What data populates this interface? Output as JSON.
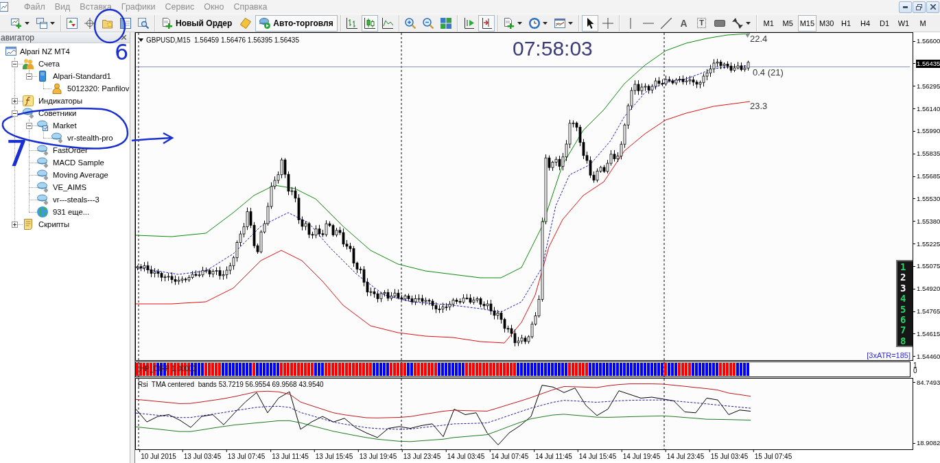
{
  "menu": {
    "items": [
      "Файл",
      "Вид",
      "Вставка",
      "Графики",
      "Сервис",
      "Окно",
      "Справка"
    ]
  },
  "toolbar": {
    "groups": [
      {
        "items": [
          {
            "kind": "icon",
            "pressed": false,
            "dropdown": true
          },
          {
            "kind": "icon",
            "pressed": false,
            "dropdown": true
          }
        ]
      },
      {
        "items": [
          {
            "kind": "icon",
            "pressed": false
          },
          {
            "kind": "icon",
            "pressed": false
          },
          {
            "kind": "icon",
            "pressed": false
          },
          {
            "kind": "icon",
            "pressed": false
          },
          {
            "kind": "icon",
            "pressed": false
          }
        ]
      },
      {
        "items": [
          {
            "kind": "button",
            "label": "Новый Ордер",
            "pressed": false
          },
          {
            "kind": "icon",
            "pressed": false
          },
          {
            "kind": "button",
            "label": "Авто-торговля",
            "pressed": true
          }
        ]
      },
      {
        "items": [
          {
            "kind": "icon",
            "pressed": false
          },
          {
            "kind": "icon",
            "pressed": true
          },
          {
            "kind": "icon",
            "pressed": false
          }
        ]
      },
      {
        "items": [
          {
            "kind": "icon",
            "pressed": false
          },
          {
            "kind": "icon",
            "pressed": false
          },
          {
            "kind": "icon",
            "pressed": false
          }
        ]
      },
      {
        "items": [
          {
            "kind": "icon",
            "pressed": false
          },
          {
            "kind": "icon",
            "pressed": true
          }
        ]
      },
      {
        "items": [
          {
            "kind": "icon",
            "pressed": false,
            "dropdown": true
          },
          {
            "kind": "icon",
            "pressed": false,
            "dropdown": true
          },
          {
            "kind": "icon",
            "pressed": false,
            "dropdown": true
          }
        ]
      },
      {
        "items": [
          {
            "kind": "icon",
            "pressed": true
          },
          {
            "kind": "icon",
            "pressed": false
          }
        ]
      },
      {
        "items": [
          {
            "kind": "icon",
            "pressed": false
          },
          {
            "kind": "icon",
            "pressed": false
          },
          {
            "kind": "icon",
            "pressed": false
          },
          {
            "kind": "glyph",
            "label": "A",
            "pressed": false
          },
          {
            "kind": "boxed-glyph",
            "label": "T",
            "pressed": false
          },
          {
            "kind": "icon",
            "pressed": false
          },
          {
            "kind": "icon",
            "pressed": false,
            "dropdown": true
          }
        ]
      }
    ]
  },
  "timeframes": [
    {
      "label": "M1",
      "selected": false
    },
    {
      "label": "M5",
      "selected": false
    },
    {
      "label": "M15",
      "selected": true
    },
    {
      "label": "M30",
      "selected": false
    },
    {
      "label": "H1",
      "selected": false
    },
    {
      "label": "H4",
      "selected": false
    },
    {
      "label": "D1",
      "selected": false
    },
    {
      "label": "W1",
      "selected": false
    },
    {
      "label": "M",
      "selected": false
    }
  ],
  "navigator": {
    "title": "авигатор",
    "tree": [
      {
        "label": "Alpari NZ MT4",
        "kind": "terminal",
        "children": [
          {
            "label": "Счета",
            "kind": "accounts",
            "expanded": true,
            "children": [
              {
                "label": "Alpari-Standard1",
                "kind": "server",
                "expanded": true,
                "children": [
                  {
                    "label": "5012320: Panfilov",
                    "kind": "account"
                  }
                ]
              }
            ]
          },
          {
            "label": "Индикаторы",
            "kind": "indicators",
            "expanded": false
          },
          {
            "label": "Советники",
            "kind": "experts",
            "expanded": true,
            "children": [
              {
                "label": "Market",
                "kind": "expert-folder",
                "expanded": true,
                "children": [
                  {
                    "label": "vr-stealth-pro",
                    "kind": "expert"
                  }
                ]
              },
              {
                "label": "FastOrder",
                "kind": "expert"
              },
              {
                "label": "MACD Sample",
                "kind": "expert"
              },
              {
                "label": "Moving Average",
                "kind": "expert"
              },
              {
                "label": "VE_AIMS",
                "kind": "expert"
              },
              {
                "label": "vr---steals---3",
                "kind": "expert"
              },
              {
                "label": "931 еще...",
                "kind": "more"
              }
            ]
          },
          {
            "label": "Скрипты",
            "kind": "scripts",
            "expanded": false
          }
        ]
      }
    ]
  },
  "chart": {
    "header": "GBPUSD,M15  1.56459 1.56476 1.56395 1.56435",
    "clock": "07:58:03",
    "level_labels": [
      "22.4",
      "0.4 (21)",
      "23.3"
    ],
    "signal_panel": [
      {
        "text": "1",
        "color": "#2ad26c"
      },
      {
        "text": "2",
        "color": "#ffffff"
      },
      {
        "text": "3",
        "color": "#ffffff"
      },
      {
        "text": "4",
        "color": "#2ad26c"
      },
      {
        "text": "5",
        "color": "#2ad26c"
      },
      {
        "text": "6",
        "color": "#2ad26c"
      },
      {
        "text": "7",
        "color": "#2ad26c"
      },
      {
        "text": "8",
        "color": "#2ad26c"
      }
    ],
    "atr_label": "[3xATR=185]",
    "price_axis": [
      {
        "text": "1.56600",
        "kind": "tick"
      },
      {
        "text": "1.56435",
        "kind": "current"
      },
      {
        "text": "1.56295",
        "kind": "tick"
      },
      {
        "text": "1.56140",
        "kind": "tick"
      },
      {
        "text": "1.55990",
        "kind": "tick"
      },
      {
        "text": "1.55835",
        "kind": "tick"
      },
      {
        "text": "1.55685",
        "kind": "tick"
      },
      {
        "text": "1.55530",
        "kind": "tick"
      },
      {
        "text": "1.55380",
        "kind": "tick"
      },
      {
        "text": "1.55225",
        "kind": "tick"
      },
      {
        "text": "1.55075",
        "kind": "tick"
      },
      {
        "text": "1.54920",
        "kind": "tick"
      },
      {
        "text": "1.54765",
        "kind": "tick"
      },
      {
        "text": "1.54615",
        "kind": "tick"
      },
      {
        "text": "1.54460",
        "kind": "tick"
      }
    ]
  },
  "direction_pane": {
    "title": "HP_DIRP 1.00000",
    "axis_labels": [
      "1",
      "0"
    ]
  },
  "rsi_pane": {
    "chart_data": {
      "type": "line",
      "title": "Rsi  TMA centered  bands 53.7219 56.9554 69.9568 43.9540",
      "categories": [
        null,
        null,
        "10 Jul 2015",
        null,
        null,
        null,
        "13 Jul 03:45",
        null,
        null,
        null,
        "13 Jul 07:45",
        null,
        null,
        null,
        "13 Jul 11:45",
        null,
        null,
        null,
        "13 Jul 15:45",
        null,
        null,
        null,
        "13 Jul 19:45",
        null,
        null,
        null,
        "13 Jul 23:45",
        null,
        null,
        null,
        "14 Jul 03:45",
        null,
        null,
        null,
        "14 Jul 07:45",
        null,
        null,
        null,
        "14 Jul 11:45",
        null,
        null,
        null,
        "14 Jul 15:45",
        null,
        null,
        null,
        "14 Jul 19:45",
        null,
        null,
        null,
        "14 Jul 23:45",
        null,
        null,
        null,
        "15 Jul 03:45",
        null,
        null,
        null,
        "15 Jul 07:45",
        null,
        null,
        null,
        null,
        null,
        null,
        null,
        null,
        null,
        null,
        null,
        null
      ],
      "ylim": [
        12.25,
        89.2
      ],
      "yticks": [
        {
          "value": 84.7493,
          "label": "84.7493"
        },
        {
          "value": 18.9082,
          "label": "18.9082"
        }
      ],
      "series": [
        {
          "color": "#000000",
          "line_style": "solid",
          "values": [
            56,
            42,
            48,
            50,
            44,
            36,
            48,
            50,
            39,
            52,
            64,
            74,
            52,
            68,
            75,
            34,
            42,
            48,
            42,
            46,
            36,
            30,
            25,
            35,
            37,
            35,
            38,
            40,
            26,
            56,
            50,
            52,
            30,
            17,
            30,
            38,
            48,
            82,
            80,
            74,
            79,
            60,
            49,
            56,
            76,
            72,
            68,
            69,
            67,
            65,
            53,
            52,
            68,
            66,
            50,
            55,
            53.7,
            null,
            null,
            null,
            null,
            null,
            null,
            null,
            null,
            null,
            null,
            null,
            null,
            null,
            null
          ]
        },
        {
          "color": "#1c1c9c",
          "line_style": "dashed",
          "values": [
            51.7,
            50.5,
            49.3,
            48.1,
            46.8,
            46.9,
            48.7,
            50.5,
            52.3,
            54.3,
            56.1,
            58.0,
            58.8,
            59.1,
            57.9,
            52.4,
            48.9,
            45.4,
            41.9,
            39.7,
            37.7,
            35.8,
            34.8,
            34.4,
            34.0,
            34.3,
            35.7,
            37.1,
            38.5,
            40.0,
            40.3,
            40.6,
            41.0,
            45.0,
            49.1,
            53.1,
            57.1,
            60.3,
            63.4,
            65.5,
            64.9,
            64.1,
            63.4,
            64.3,
            65.1,
            65.6,
            65.8,
            65.9,
            65.9,
            65.0,
            63.9,
            62.8,
            61.7,
            60.4,
            59.3,
            58.1,
            57.0,
            null,
            null,
            null,
            null,
            null,
            null,
            null,
            null,
            null,
            null,
            null,
            null,
            null,
            null
          ]
        },
        {
          "color": "#c0161b",
          "line_style": "solid",
          "values": [
            66.6,
            65.5,
            64.3,
            63.2,
            62.0,
            62.2,
            63.9,
            65.6,
            67.4,
            69.7,
            72.3,
            75.0,
            75.5,
            74.8,
            72.3,
            63.7,
            59.8,
            55.9,
            52.0,
            49.8,
            48.2,
            46.6,
            46.4,
            46.7,
            47.0,
            47.9,
            49.9,
            51.8,
            53.7,
            54.8,
            54.4,
            54.1,
            53.8,
            57.4,
            61.1,
            64.7,
            68.6,
            72.9,
            77.1,
            80.6,
            80.3,
            79.9,
            79.5,
            81.4,
            82.8,
            83.5,
            83.5,
            83.5,
            83.2,
            82.0,
            80.8,
            79.5,
            78.3,
            76.8,
            73.5,
            71.8,
            70.0,
            null,
            null,
            null,
            null,
            null,
            null,
            null,
            null,
            null,
            null,
            null,
            null,
            null,
            null
          ]
        },
        {
          "color": "#1e7b1e",
          "line_style": "solid",
          "values": [
            36.7,
            35.4,
            34.2,
            32.9,
            31.6,
            31.6,
            33.4,
            35.3,
            37.1,
            38.8,
            39.9,
            41.0,
            42.1,
            43.3,
            43.4,
            41.1,
            38.0,
            34.9,
            31.8,
            29.5,
            27.2,
            25.0,
            23.2,
            22.1,
            21.0,
            20.6,
            21.5,
            22.4,
            23.2,
            25.1,
            26.1,
            27.1,
            28.2,
            32.6,
            37.1,
            41.5,
            45.5,
            47.6,
            49.6,
            50.4,
            49.4,
            48.3,
            47.2,
            47.1,
            47.4,
            47.7,
            48.0,
            48.3,
            48.6,
            47.9,
            46.9,
            46.0,
            45.0,
            44.8,
            44.6,
            44.3,
            44.0,
            null,
            null,
            null,
            null,
            null,
            null,
            null,
            null,
            null,
            null,
            null,
            null,
            null,
            null
          ]
        }
      ]
    }
  },
  "annotations": [
    {
      "kind": "circle"
    },
    {
      "kind": "text",
      "text": "6"
    },
    {
      "kind": "ellipse"
    },
    {
      "kind": "arrow"
    },
    {
      "kind": "text",
      "text": "7"
    }
  ]
}
